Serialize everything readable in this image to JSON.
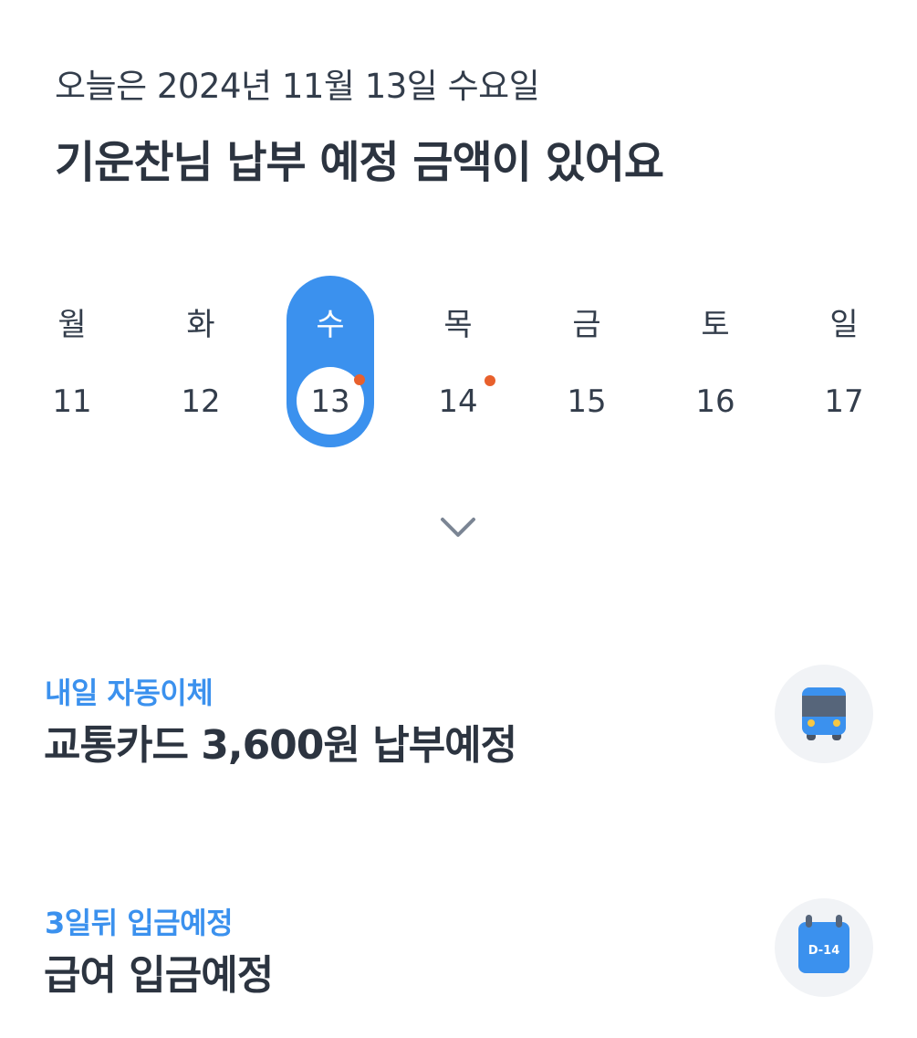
{
  "header": {
    "date_line": "오늘은 2024년 11월 13일 수요일",
    "headline": "기운찬님 납부 예정 금액이 있어요"
  },
  "week": {
    "days": [
      {
        "dow": "월",
        "date": "11"
      },
      {
        "dow": "화",
        "date": "12"
      },
      {
        "dow": "수",
        "date": "13"
      },
      {
        "dow": "목",
        "date": "14"
      },
      {
        "dow": "금",
        "date": "15"
      },
      {
        "dow": "토",
        "date": "16"
      },
      {
        "dow": "일",
        "date": "17"
      }
    ],
    "selected_date": "13",
    "event_dates": [
      "13",
      "14"
    ],
    "accent_color": "#3b91ee",
    "event_dot_color": "#e8602c"
  },
  "expand_icon": "chevron-down-icon",
  "schedule": [
    {
      "subtitle": "내일 자동이체",
      "title": "교통카드 3,600원 납부예정",
      "icon": "bus-icon"
    },
    {
      "subtitle": "3일뒤 입금예정",
      "title": "급여 입금예정",
      "icon": "calendar-icon",
      "icon_label": "D-14"
    }
  ]
}
